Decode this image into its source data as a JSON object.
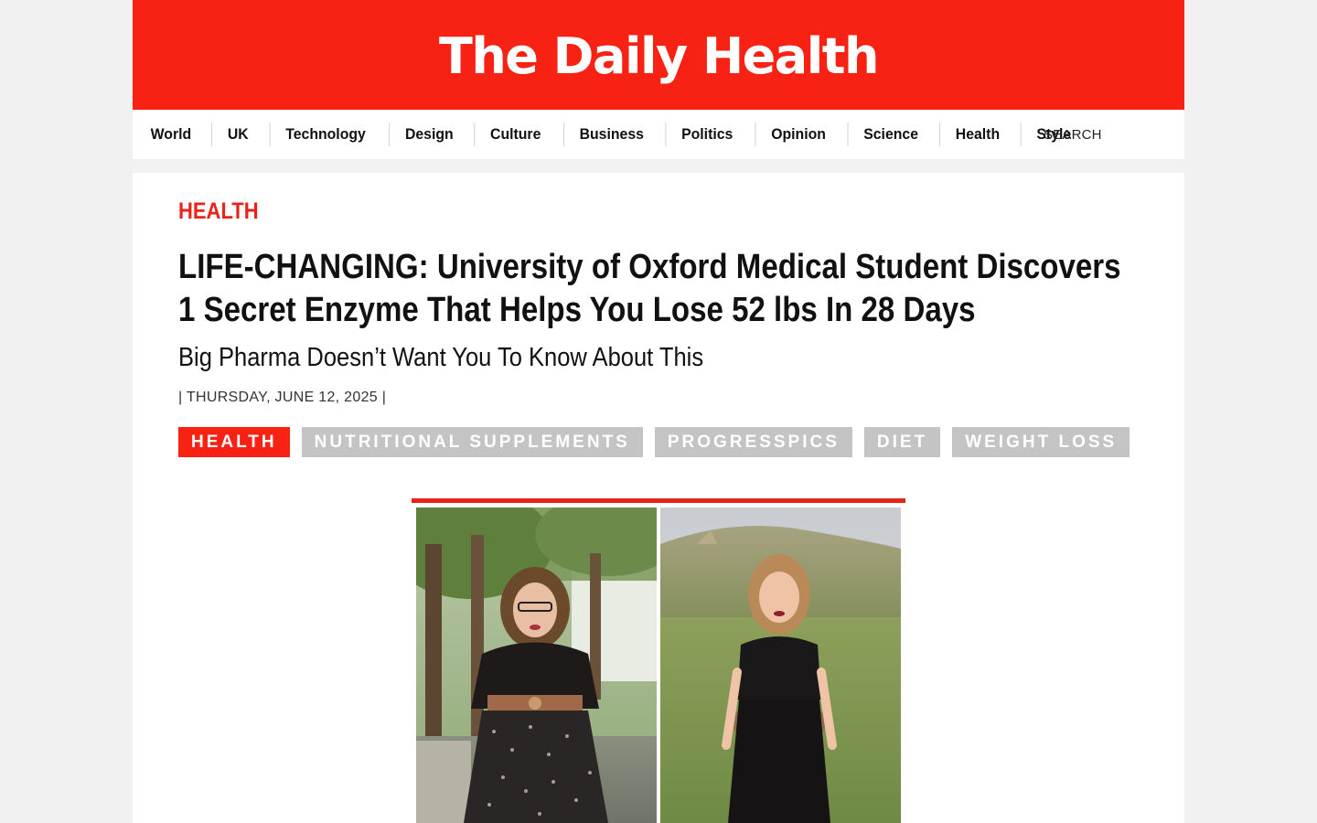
{
  "masthead": {
    "title": "The Daily Health"
  },
  "nav": {
    "items": [
      "World",
      "UK",
      "Technology",
      "Design",
      "Culture",
      "Business",
      "Politics",
      "Opinion",
      "Science",
      "Health",
      "Style"
    ],
    "search_label": "SEARCH"
  },
  "article": {
    "section": "HEALTH",
    "headline": "LIFE-CHANGING: University of Oxford Medical Student Discovers 1 Secret Enzyme That Helps You Lose 52 lbs In 28 Days",
    "subheadline": "Big Pharma Doesn’t Want You To Know About This",
    "date": "| THURSDAY, JUNE 12, 2025 |",
    "tags": [
      "HEALTH",
      "NUTRITIONAL SUPPLEMENTS",
      "PROGRESSPICS",
      "DIET",
      "WEIGHT LOSS"
    ]
  },
  "colors": {
    "brand_red": "#f82214",
    "tag_gray": "#c4c4c4",
    "section_red": "#e8231a"
  }
}
